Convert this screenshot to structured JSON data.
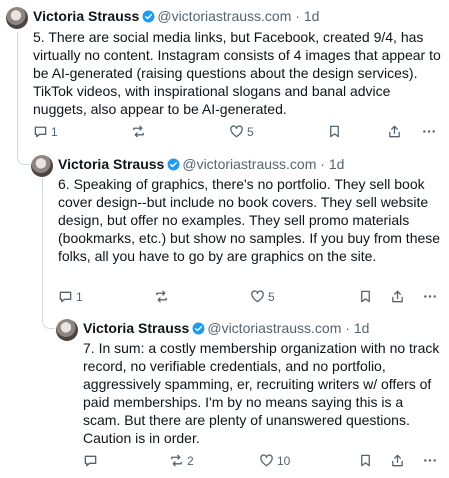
{
  "posts": [
    {
      "author": "Victoria Strauss",
      "handle": "@victoriastrauss.com",
      "separator": "·",
      "time": "1d",
      "text": "5. There are social media links, but Facebook, created 9/4, has virtually no content. Instagram consists of 4 images that appear to be AI-generated (raising questions about the design services). TikTok videos, with inspirational slogans and banal advice nuggets, also appear to be AI-generated.",
      "replies": "1",
      "reposts": "",
      "likes": "5"
    },
    {
      "author": "Victoria Strauss",
      "handle": "@victoriastrauss.com",
      "separator": "·",
      "time": "1d",
      "text": "6. Speaking of graphics, there's no portfolio. They sell book cover design--but include no book covers. They sell website design, but offer no examples. They sell promo materials (bookmarks, etc.) but show no samples. If you buy from these folks, all you have to go by are graphics on the site.",
      "replies": "1",
      "reposts": "",
      "likes": "5"
    },
    {
      "author": "Victoria Strauss",
      "handle": "@victoriastrauss.com",
      "separator": "·",
      "time": "1d",
      "text": "7. In sum: a costly membership organization with no track record, no verifiable credentials, and no portfolio, aggressively spamming, er, recruiting writers w/ offers of paid memberships. I'm by no means saying this is a scam. But there are plenty of unanswered questions. Caution is in order.",
      "replies": "",
      "reposts": "2",
      "likes": "10"
    }
  ],
  "icons": {
    "reply": "reply-icon",
    "repost": "repost-icon",
    "like": "heart-icon",
    "bookmark": "bookmark-icon",
    "share": "share-icon",
    "more": "more-icon",
    "verified": "verified-badge-icon"
  },
  "colors": {
    "text": "#0f1419",
    "muted": "#536471",
    "verified": "#1d9bf0",
    "thread_line": "#cfd9de"
  }
}
